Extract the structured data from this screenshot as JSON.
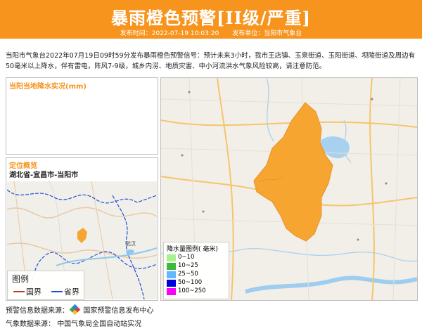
{
  "header": {
    "title": "暴雨橙色预警[II级/严重]",
    "publish_time": "发布时间：2022-07-19 10:03:20",
    "publisher": "发布单位：当阳市气象台"
  },
  "description": "当阳市气象台2022年07月19日09时59分发布暴雨橙色预警信号：预计未来3小时，我市王店镇、玉泉街道、玉阳街道、坝陵街道及周边有50毫米以上降水，伴有雷电，阵风7-9级，城乡内涝、地质灾害、中小河流洪水气象风险较高，请注意防范。",
  "rainfall_panel": {
    "title": "当阳当地降水实况(mm)"
  },
  "location_panel": {
    "title": "定位概览",
    "region": "湖北省-宜昌市-当阳市",
    "city_label": "武汉",
    "legend_title": "图例",
    "legend_items": [
      {
        "label": "国界",
        "color": "#c0392b"
      },
      {
        "label": "省界",
        "color": "#1f4fd6"
      }
    ]
  },
  "map": {
    "area_color": "#f7a531",
    "legend_title": "降水量图例( 毫米)",
    "legend_items": [
      {
        "label": "0~10",
        "color": "#a6f28f"
      },
      {
        "label": "10~25",
        "color": "#3dba3d"
      },
      {
        "label": "25~50",
        "color": "#61b8ff"
      },
      {
        "label": "50~100",
        "color": "#0000e1"
      },
      {
        "label": "100~250",
        "color": "#fa00fa"
      }
    ]
  },
  "footer": {
    "warning_source_label": "预警信息数据来源：",
    "warning_source_value": "国家预警信息发布中心",
    "weather_source_label": "气象数据来源：",
    "weather_source_value": "中国气象局全国自动站实况"
  },
  "colors": {
    "accent": "#f7941d"
  }
}
